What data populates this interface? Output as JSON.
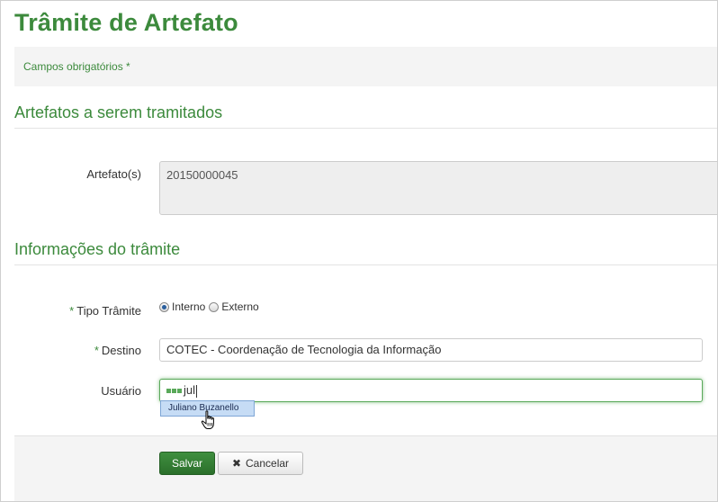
{
  "page": {
    "title": "Trâmite de Artefato",
    "required_note": "Campos obrigatórios *"
  },
  "section_artefatos": {
    "title": "Artefatos a serem tramitados",
    "label": "Artefato(s)",
    "value": "20150000045"
  },
  "section_info": {
    "title": "Informações do trâmite",
    "tipo_label": "Tipo Trâmite",
    "tipo_options": [
      "Interno",
      "Externo"
    ],
    "tipo_selected": "Interno",
    "destino_label": "Destino",
    "destino_value": "COTEC - Coordenação de Tecnologia da Informação",
    "usuario_label": "Usuário",
    "usuario_value": "jul",
    "required_mark": "*",
    "suggestion": "Juliano Buzanello"
  },
  "actions": {
    "save_label": "Salvar",
    "cancel_label": "Cancelar"
  },
  "colors": {
    "accent": "#3c8a3c",
    "focus": "#5aa95a",
    "suggestion_bg": "#c6dcf5"
  },
  "icons": [
    "radio-checked-icon",
    "radio-unchecked-icon",
    "loading-dots-icon",
    "hand-pointer-icon",
    "close-icon"
  ]
}
